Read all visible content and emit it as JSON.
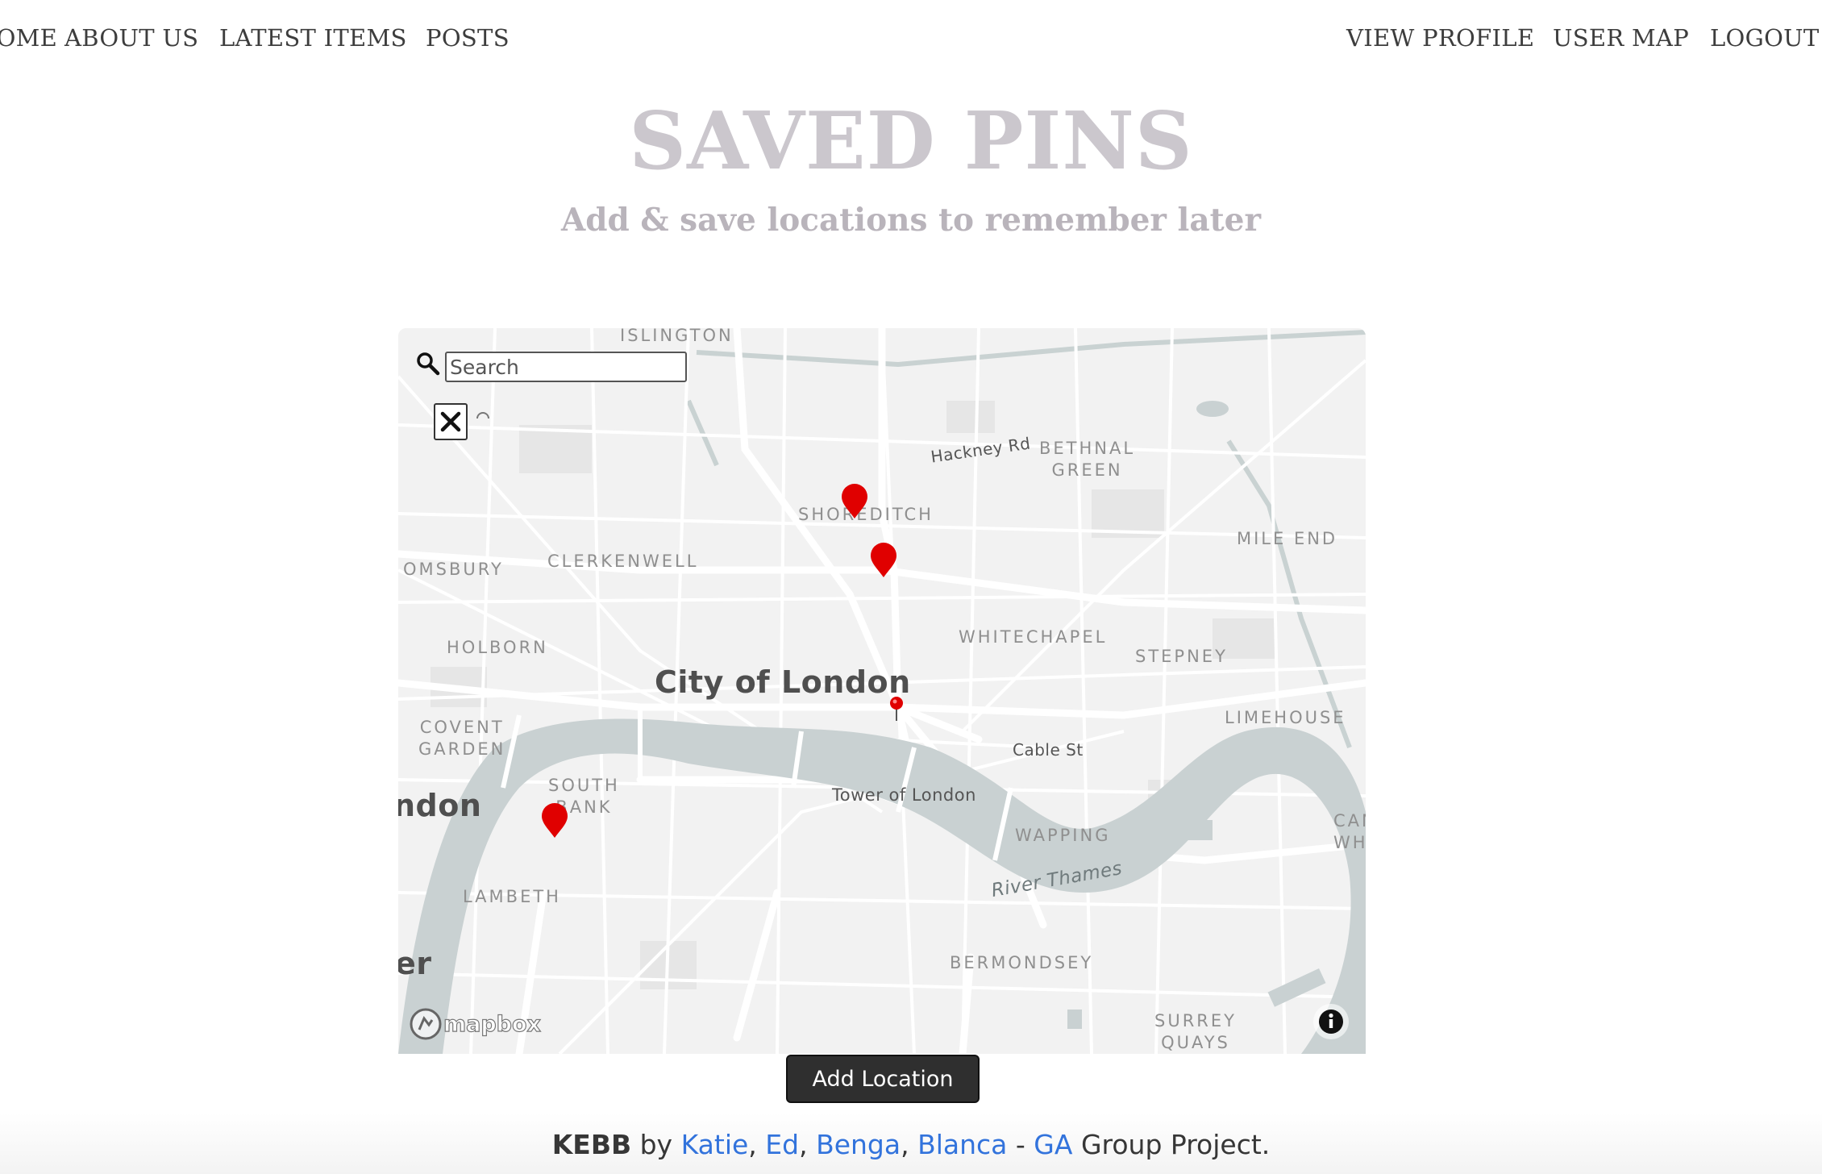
{
  "nav": {
    "home": "HOME",
    "about": "ABOUT US",
    "latest": "LATEST ITEMS",
    "posts": "POSTS",
    "profile": "VIEW PROFILE",
    "usermap": "USER MAP",
    "logout": "LOGOUT"
  },
  "header": {
    "title": "SAVED PINS",
    "subtitle": "Add & save locations to remember later"
  },
  "map": {
    "search_placeholder": "Search",
    "labels": {
      "islington": "ISLINGTON",
      "hackney_rd": "Hackney Rd",
      "bethnal_green": "BETHNAL\nGREEN",
      "shoreditch": "SHOREDITCH",
      "mile_end": "MILE END",
      "bloomsbury": "OMSBURY",
      "clerkenwell": "CLERKENWELL",
      "whitechapel": "WHITECHAPEL",
      "stepney": "STEPNEY",
      "holborn": "HOLBORN",
      "city_of_london": "City of London",
      "limehouse": "LIMEHOUSE",
      "covent_garden": "COVENT\nGARDEN",
      "cable_st": "Cable St",
      "south_bank": "SOUTH\nBANK",
      "london": "ndon",
      "tower_of_london": "Tower of London",
      "wapping": "WAPPING",
      "canary_wharf": "CAN\nWH",
      "river_thames": "River Thames",
      "lambeth": "LAMBETH",
      "westminster": "er",
      "bermondsey": "BERMONDSEY",
      "surrey_quays": "SURREY\nQUAYS"
    },
    "attribution": "mapbox",
    "pin_color": "#e00000"
  },
  "actions": {
    "add_location": "Add Location"
  },
  "footer": {
    "brand": "KEBB",
    "by": " by ",
    "katie": "Katie",
    "ed": "Ed",
    "benga": "Benga",
    "blanca": "Blanca",
    "dash": " - ",
    "ga": "GA",
    "rest": " Group Project.",
    "comma": ", "
  }
}
